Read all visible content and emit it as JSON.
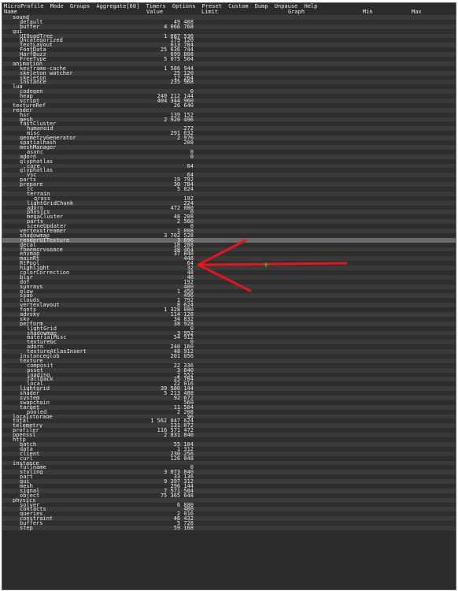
{
  "menu": [
    "MicroProfile",
    "Mode",
    "Groups",
    "Aggregate[60]",
    "Timers",
    "Options",
    "Preset",
    "Custom",
    "Dump",
    "Unpause",
    "Help"
  ],
  "columns": {
    "name": "Name",
    "value": "Value",
    "limit": "Limit",
    "graph": "Graph",
    "min": "Min",
    "max": "Max"
  },
  "colors": {
    "annotation": "#e8141c",
    "cursor": "#19e619",
    "highlight_row": "#6a6a6a"
  },
  "rows": [
    {
      "name": "sound",
      "value": "",
      "indent": 1
    },
    {
      "name": "default",
      "value": "49 408",
      "indent": 2
    },
    {
      "name": "buffer",
      "value": "4 066 768",
      "indent": 2
    },
    {
      "name": "gui",
      "value": "",
      "indent": 1
    },
    {
      "name": "UIQuadTree",
      "value": "1 087 536",
      "indent": 2
    },
    {
      "name": "Uncategorized",
      "value": "179 120",
      "indent": 2
    },
    {
      "name": "TextLayout",
      "value": "613 784",
      "indent": 2
    },
    {
      "name": "FontData",
      "value": "25 636 744",
      "indent": 2
    },
    {
      "name": "HarfBuzz",
      "value": "699 808",
      "indent": 2
    },
    {
      "name": "FreeType",
      "value": "5 075 504",
      "indent": 2
    },
    {
      "name": "animation",
      "value": "",
      "indent": 1
    },
    {
      "name": "keyframe-cache",
      "value": "1 586 944",
      "indent": 2
    },
    {
      "name": "skeleton_watcher",
      "value": "25 120",
      "indent": 2
    },
    {
      "name": "skeleton",
      "value": "17 264",
      "indent": 2
    },
    {
      "name": "instance",
      "value": "235 968",
      "indent": 2
    },
    {
      "name": "lua",
      "value": "",
      "indent": 1
    },
    {
      "name": "codegen",
      "value": "0",
      "indent": 2
    },
    {
      "name": "heap",
      "value": "240 212 144",
      "indent": 2
    },
    {
      "name": "script",
      "value": "404 344 960",
      "indent": 2
    },
    {
      "name": "textureRef",
      "value": "26 640",
      "indent": 1
    },
    {
      "name": "render",
      "value": "",
      "indent": 1
    },
    {
      "name": "hsr",
      "value": "139 152",
      "indent": 2
    },
    {
      "name": "mesh",
      "value": "2 920 496",
      "indent": 2
    },
    {
      "name": "fastCluster",
      "value": "",
      "indent": 2
    },
    {
      "name": "humanoid",
      "value": "272",
      "indent": 3
    },
    {
      "name": "misc",
      "value": "291 632",
      "indent": 3
    },
    {
      "name": "geometryGenerator",
      "value": "2 976",
      "indent": 2
    },
    {
      "name": "spatialhash",
      "value": "208",
      "indent": 2
    },
    {
      "name": "meshManager",
      "value": "",
      "indent": 2
    },
    {
      "name": "async",
      "value": "0",
      "indent": 3
    },
    {
      "name": "adorn",
      "value": "0",
      "indent": 2
    },
    {
      "name": "glyphatlas",
      "value": "",
      "indent": 2
    },
    {
      "name": "core",
      "value": "64",
      "indent": 3
    },
    {
      "name": "glyphatlas",
      "value": "",
      "indent": 2
    },
    {
      "name": "vsc",
      "value": "64",
      "indent": 3
    },
    {
      "name": "parts",
      "value": "19 792",
      "indent": 2
    },
    {
      "name": "prepare",
      "value": "30 784",
      "indent": 2
    },
    {
      "name": "tc",
      "value": "5 024",
      "indent": 3
    },
    {
      "name": "terrain",
      "value": "",
      "indent": 3
    },
    {
      "name": "grass",
      "value": "192",
      "indent": 4
    },
    {
      "name": "lightGridChunk",
      "value": "224",
      "indent": 3
    },
    {
      "name": "adorn",
      "value": "472 080",
      "indent": 3
    },
    {
      "name": "physics",
      "value": "0",
      "indent": 3
    },
    {
      "name": "megaCluster",
      "value": "48 208",
      "indent": 3
    },
    {
      "name": "parts",
      "value": "2 560",
      "indent": 3
    },
    {
      "name": "sceneUpdater",
      "value": "0",
      "indent": 3
    },
    {
      "name": "vertexstreamer",
      "value": "1 008",
      "indent": 2
    },
    {
      "name": "shadowmap",
      "value": "3 702 528",
      "indent": 2
    },
    {
      "name": "renderUITexture",
      "value": "3 896",
      "indent": 2,
      "highlight": true
    },
    {
      "name": "decal",
      "value": "18 288",
      "indent": 2
    },
    {
      "name": "fbmemoryspace",
      "value": "38 464",
      "indent": 2
    },
    {
      "name": "envmap",
      "value": "37 840",
      "indent": 2
    },
    {
      "name": "mainRt",
      "value": "448",
      "indent": 2
    },
    {
      "name": "RtPool",
      "value": "64",
      "indent": 2
    },
    {
      "name": "highlight",
      "value": "32",
      "indent": 2
    },
    {
      "name": "colorCorrection",
      "value": "48",
      "indent": 2
    },
    {
      "name": "blur",
      "value": "48",
      "indent": 2
    },
    {
      "name": "dof",
      "value": "192",
      "indent": 2
    },
    {
      "name": "sunrays",
      "value": "480",
      "indent": 2
    },
    {
      "name": "glow",
      "value": "1 456",
      "indent": 2
    },
    {
      "name": "ssao",
      "value": "496",
      "indent": 2
    },
    {
      "name": "clouds",
      "value": "1 792",
      "indent": 2
    },
    {
      "name": "vertexlayout",
      "value": "8 624",
      "indent": 2
    },
    {
      "name": "fonts",
      "value": "1 328 080",
      "indent": 2
    },
    {
      "name": "advsky",
      "value": "114 128",
      "indent": 2
    },
    {
      "name": "sky",
      "value": "34 832",
      "indent": 2
    },
    {
      "name": "perform",
      "value": "38 928",
      "indent": 2
    },
    {
      "name": "lightGrid",
      "value": "0",
      "indent": 3
    },
    {
      "name": "shadowmap",
      "value": "3 952",
      "indent": 3
    },
    {
      "name": "materialMisc",
      "value": "54 912",
      "indent": 3
    },
    {
      "name": "textureGc",
      "value": "0",
      "indent": 3
    },
    {
      "name": "adorn",
      "value": "240 160",
      "indent": 3
    },
    {
      "name": "textureAtlasInsert",
      "value": "48 912",
      "indent": 3
    },
    {
      "name": "instanceglob",
      "value": "201 056",
      "indent": 2
    },
    {
      "name": "texture",
      "value": "",
      "indent": 2
    },
    {
      "name": "composit",
      "value": "22 336",
      "indent": 3
    },
    {
      "name": "asset",
      "value": "3 840",
      "indent": 3
    },
    {
      "name": "loading",
      "value": "2 552",
      "indent": 3
    },
    {
      "name": "fallback",
      "value": "25 784",
      "indent": 3
    },
    {
      "name": "local",
      "value": "22 016",
      "indent": 3
    },
    {
      "name": "lightgrid",
      "value": "39 580 144",
      "indent": 2
    },
    {
      "name": "shader",
      "value": "5 213 488",
      "indent": 2
    },
    {
      "name": "system",
      "value": "92 672",
      "indent": 2
    },
    {
      "name": "swapchain",
      "value": "560",
      "indent": 2
    },
    {
      "name": "target",
      "value": "11 504",
      "indent": 2
    },
    {
      "name": "pooled",
      "value": "2 208",
      "indent": 3
    },
    {
      "name": "localstorage",
      "value": "96",
      "indent": 1
    },
    {
      "name": "total",
      "value": "1 562 047 624",
      "indent": 1
    },
    {
      "name": "telemetry",
      "value": "131 072",
      "indent": 1
    },
    {
      "name": "profiler",
      "value": "116 571 472",
      "indent": 1
    },
    {
      "name": "openssl",
      "value": "2 831 840",
      "indent": 1
    },
    {
      "name": "http",
      "value": "",
      "indent": 1
    },
    {
      "name": "batch",
      "value": "55 104",
      "indent": 2
    },
    {
      "name": "data",
      "value": "1 312",
      "indent": 2
    },
    {
      "name": "client",
      "value": "230 256",
      "indent": 2
    },
    {
      "name": "curl",
      "value": "126 048",
      "indent": 2
    },
    {
      "name": "instance",
      "value": "",
      "indent": 1
    },
    {
      "name": "fullname",
      "value": "0",
      "indent": 2
    },
    {
      "name": "styling",
      "value": "3 073 840",
      "indent": 2
    },
    {
      "name": "part",
      "value": "33 136",
      "indent": 2
    },
    {
      "name": "gui",
      "value": "9 397 312",
      "indent": 2
    },
    {
      "name": "mesh",
      "value": "296 144",
      "indent": 2
    },
    {
      "name": "signal",
      "value": "7 571 584",
      "indent": 2
    },
    {
      "name": "object",
      "value": "75 365 648",
      "indent": 2
    },
    {
      "name": "physics",
      "value": "",
      "indent": 1
    },
    {
      "name": "solver",
      "value": "6 880",
      "indent": 2
    },
    {
      "name": "contacts",
      "value": "400",
      "indent": 2
    },
    {
      "name": "queries",
      "value": "2 016",
      "indent": 2
    },
    {
      "name": "constraint",
      "value": "46 432",
      "indent": 2
    },
    {
      "name": "buffers",
      "value": "5 728",
      "indent": 2
    },
    {
      "name": "step",
      "value": "59 168",
      "indent": 2
    }
  ]
}
